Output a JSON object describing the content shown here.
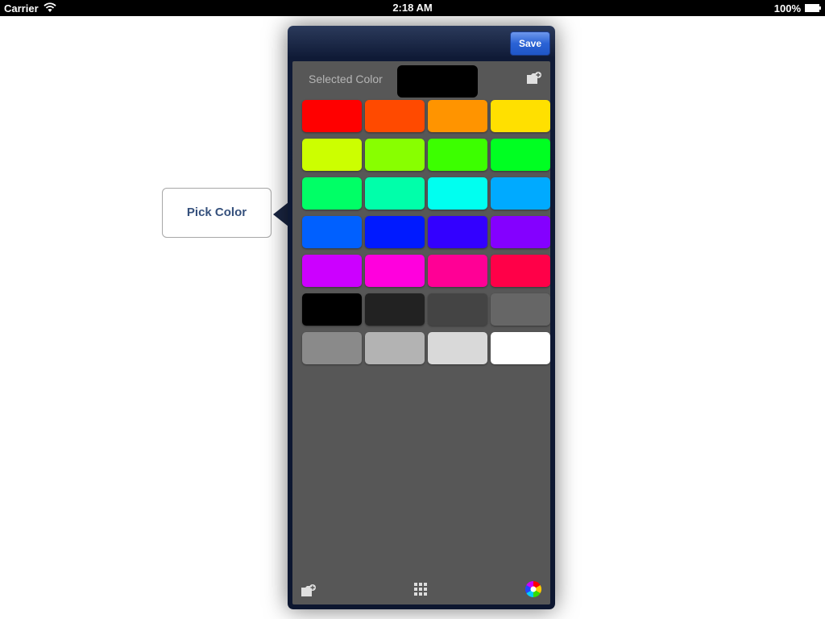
{
  "status_bar": {
    "carrier": "Carrier",
    "time": "2:18 AM",
    "battery": "100%"
  },
  "pick_button": {
    "label": "Pick Color"
  },
  "popover": {
    "save_label": "Save",
    "selected_label": "Selected Color",
    "selected_color": "#000000",
    "icons": {
      "top_right": "add-folder-icon",
      "bottom_left": "add-folder-icon",
      "bottom_center": "grid-icon",
      "bottom_right": "color-wheel-icon"
    },
    "swatches": [
      [
        "#ff0000",
        "#ff4a00",
        "#ff9400",
        "#ffe000"
      ],
      [
        "#ccff00",
        "#88ff00",
        "#3cff00",
        "#00ff22"
      ],
      [
        "#00ff66",
        "#00ffaa",
        "#00fff0",
        "#00aaff"
      ],
      [
        "#0060ff",
        "#001aff",
        "#3300ff",
        "#8400ff"
      ],
      [
        "#cc00ff",
        "#ff00dd",
        "#ff0095",
        "#ff0048"
      ],
      [
        "#000000",
        "#222222",
        "#444444",
        "#666666"
      ],
      [
        "#8a8a8a",
        "#b3b3b3",
        "#d9d9d9",
        "#ffffff"
      ]
    ]
  }
}
